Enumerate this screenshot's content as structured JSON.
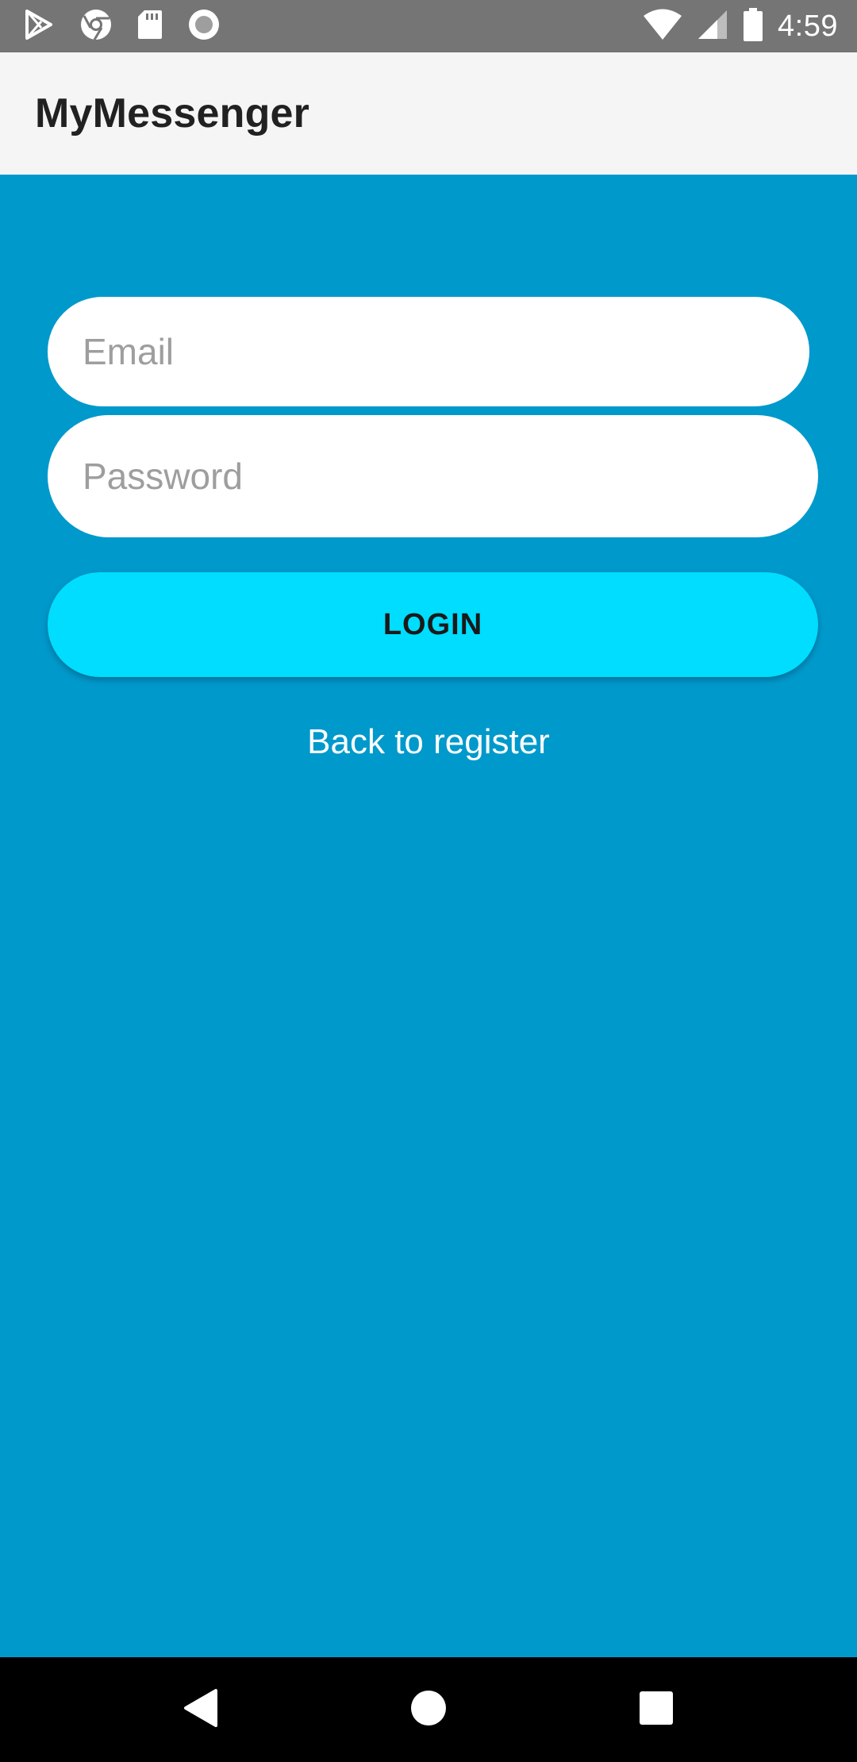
{
  "status_bar": {
    "time": "4:59",
    "left_icons": [
      "play-store-icon",
      "chrome-icon",
      "sd-card-icon",
      "record-icon"
    ],
    "right_icons": [
      "wifi-icon",
      "cell-signal-icon",
      "battery-icon"
    ]
  },
  "app_bar": {
    "title": "MyMessenger"
  },
  "login_form": {
    "email_placeholder": "Email",
    "email_value": "",
    "password_placeholder": "Password",
    "password_value": "",
    "login_label": "LOGIN",
    "register_link": "Back to register"
  },
  "colors": {
    "background": "#0099cc",
    "login_button": "#00ddff",
    "app_bar": "#f5f5f5",
    "status_bar": "#757575"
  },
  "nav_bar": {
    "icons": [
      "back-icon",
      "home-icon",
      "recents-icon"
    ]
  }
}
